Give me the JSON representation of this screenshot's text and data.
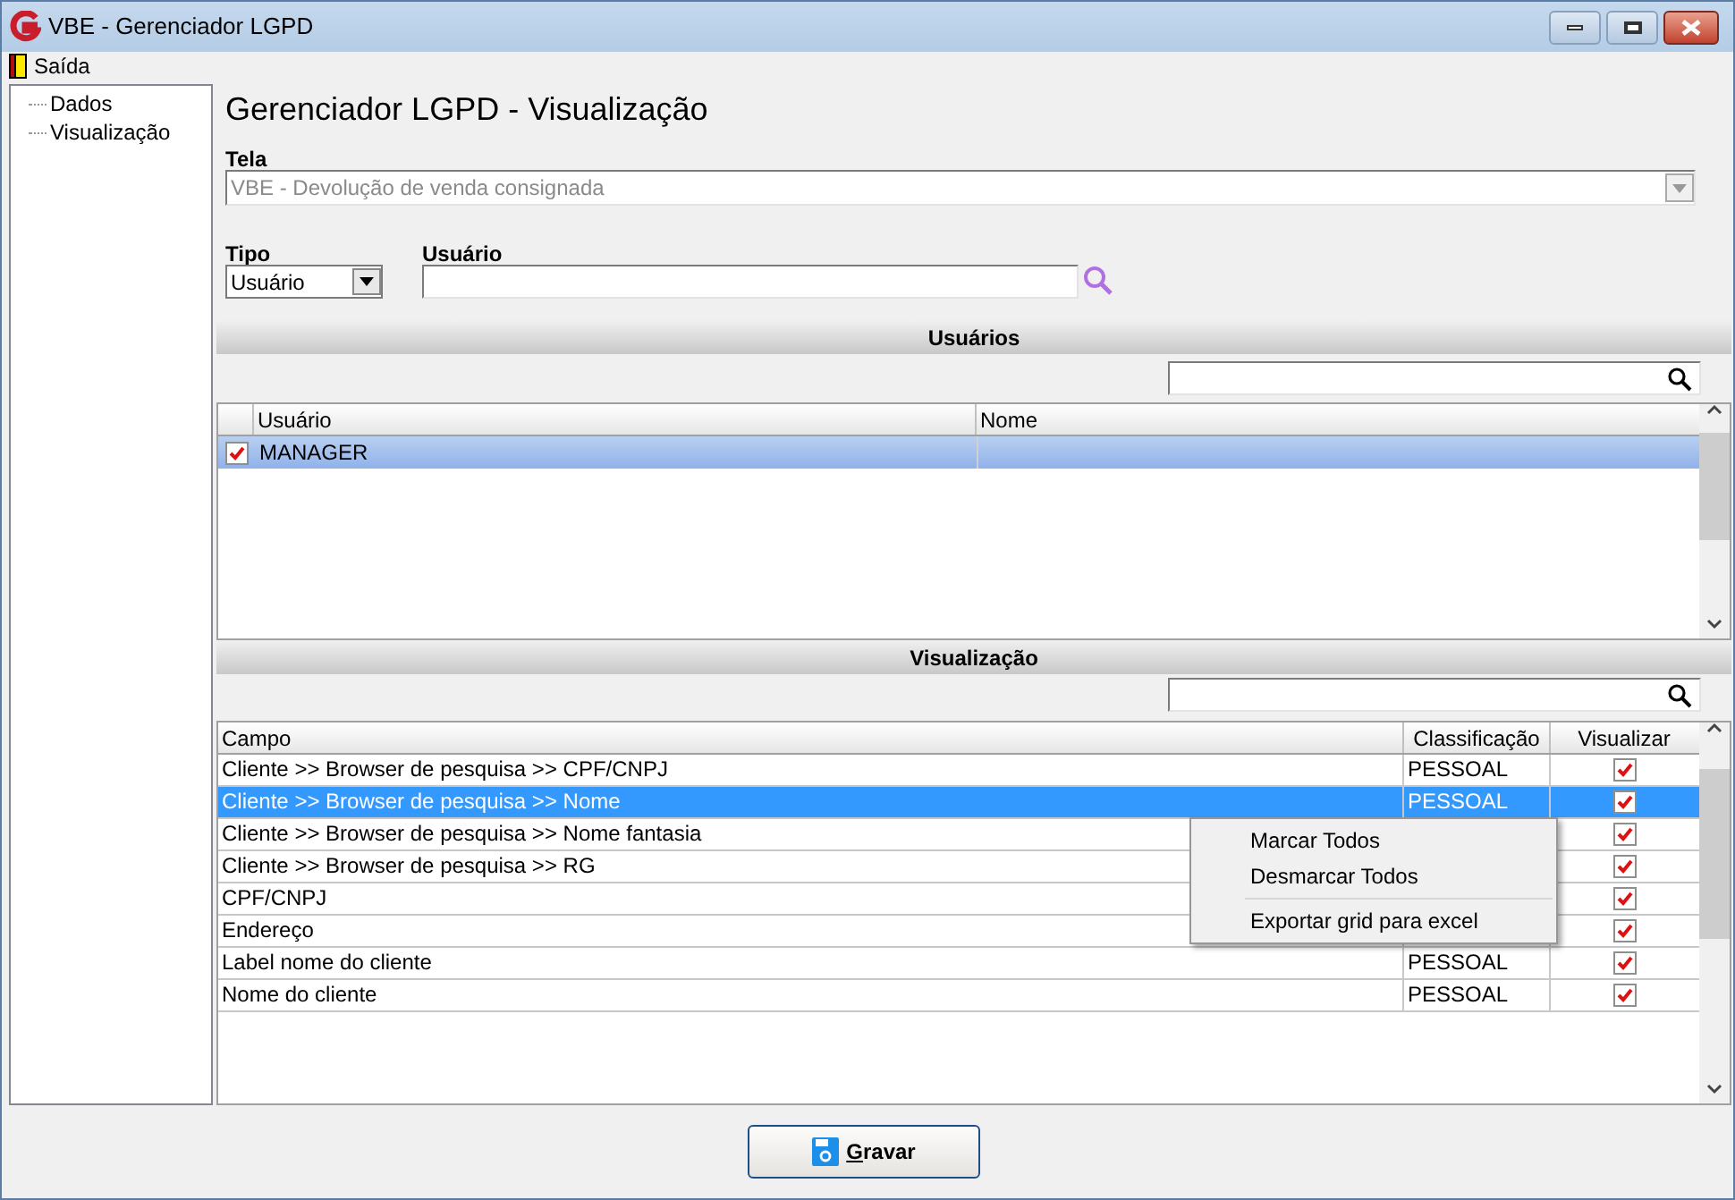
{
  "window": {
    "title": "VBE - Gerenciador LGPD"
  },
  "menu": [
    {
      "label": "Saída"
    }
  ],
  "tree": [
    {
      "label": "Dados"
    },
    {
      "label": "Visualização"
    }
  ],
  "heading": "Gerenciador LGPD - Visualização",
  "tela": {
    "label": "Tela",
    "value": "VBE - Devolução de venda consignada",
    "disabled": true
  },
  "tipo": {
    "label": "Tipo",
    "value": "Usuário"
  },
  "usuario": {
    "label": "Usuário"
  },
  "usuarios": {
    "title": "Usuários",
    "columns": [
      "Usuário",
      "Nome"
    ],
    "rows": [
      {
        "usuario": "MANAGER",
        "checked": true,
        "selected": true
      }
    ]
  },
  "visualizacao": {
    "title": "Visualização",
    "columns": [
      "Campo",
      "Classificação",
      "Visualizar"
    ],
    "rows": [
      {
        "campo": "Cliente >> Browser de pesquisa >> CPF/CNPJ",
        "classificacao": "PESSOAL",
        "checked": true,
        "selected": false
      },
      {
        "campo": "Cliente >> Browser de pesquisa >> Nome",
        "classificacao": "PESSOAL",
        "checked": true,
        "selected": true
      },
      {
        "campo": "Cliente >> Browser de pesquisa >> Nome fantasia",
        "checked": true,
        "selected": false
      },
      {
        "campo": "Cliente >> Browser de pesquisa >> RG",
        "checked": true,
        "selected": false
      },
      {
        "campo": "CPF/CNPJ",
        "checked": true,
        "selected": false
      },
      {
        "campo": "Endereço",
        "checked": true,
        "selected": false
      },
      {
        "campo": "Label nome do cliente",
        "classificacao": "PESSOAL",
        "checked": true,
        "selected": false
      },
      {
        "campo": "Nome do cliente",
        "classificacao": "PESSOAL",
        "checked": true,
        "selected": false
      }
    ]
  },
  "context_menu": [
    {
      "kind": "item",
      "label": "Marcar Todos"
    },
    {
      "kind": "item",
      "label": "Desmarcar Todos"
    },
    {
      "kind": "separator"
    },
    {
      "kind": "item",
      "label": "Exportar grid para excel"
    }
  ],
  "save_button": {
    "label": "Gravar"
  }
}
